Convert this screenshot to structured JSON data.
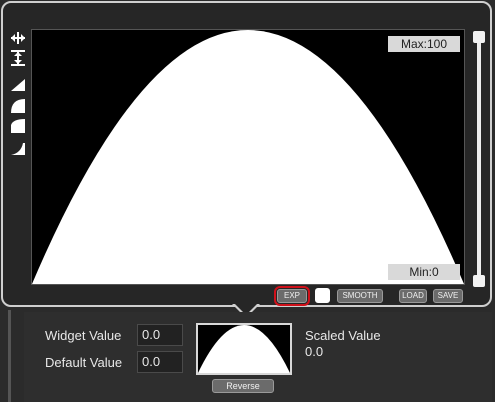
{
  "curve_editor": {
    "max_label": "Max:100",
    "min_label": "Min:0",
    "buttons": {
      "exp": "EXP",
      "smooth": "SMOOTH",
      "load": "LOAD",
      "save": "SAVE"
    },
    "tools": [
      "horizontal-arrows-icon",
      "vertical-arrows-icon",
      "ramp-icon",
      "half-circle-icon",
      "curve-up-icon",
      "curve-corner-icon"
    ],
    "curve_color": "#ffffff",
    "highlight_color": "#d0101a"
  },
  "inspector": {
    "widget_value_label": "Widget Value",
    "widget_value": "0.0",
    "default_value_label": "Default Value",
    "default_value": "0.0",
    "scaled_value_label": "Scaled Value",
    "scaled_value": "0.0",
    "reverse_label": "Reverse"
  }
}
